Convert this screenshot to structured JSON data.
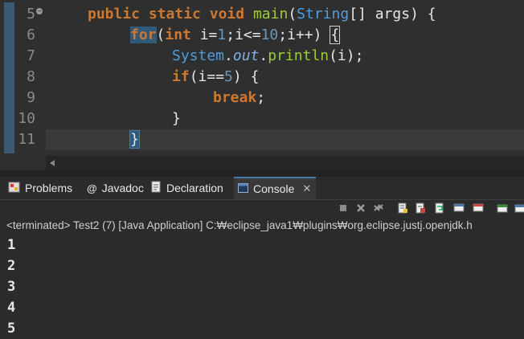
{
  "editor": {
    "line_numbers": [
      "5",
      "6",
      "7",
      "8",
      "9",
      "10",
      "11"
    ],
    "line5": {
      "kw1": "public",
      "kw2": "static",
      "kw3": "void",
      "fn": "main",
      "p1": "(",
      "ty": "String",
      "p2": "[] ",
      "arg": "args",
      "p3": ") {"
    },
    "line6": {
      "kw": "for",
      "p1": "(",
      "ty": "int",
      "p2": " i=",
      "n1": "1",
      "p3": ";i<=",
      "n2": "10",
      "p4": ";i++) ",
      "brace": "{"
    },
    "line7": {
      "ty": "System",
      "dot1": ".",
      "it": "out",
      "dot2": ".",
      "fn": "println",
      "rest": "(i);"
    },
    "line8": {
      "kw": "if",
      "p1": "(i==",
      "n": "5",
      "p2": ") {"
    },
    "line9": {
      "kw": "break",
      "p": ";"
    },
    "line10": {
      "p": "}"
    },
    "line11": {
      "p": "}"
    }
  },
  "tabs": [
    {
      "label": "Problems",
      "icon": "problems-icon"
    },
    {
      "label": "Javadoc",
      "icon": "javadoc-icon"
    },
    {
      "label": "Declaration",
      "icon": "declaration-icon"
    },
    {
      "label": "Console",
      "icon": "console-icon",
      "active": true,
      "close": "✕"
    }
  ],
  "console": {
    "status": "<terminated> Test2 (7) [Java Application] C:₩eclipse_java1₩plugins₩org.eclipse.justj.openjdk.h",
    "output": [
      "1",
      "2",
      "3",
      "4",
      "5"
    ]
  },
  "colors": {
    "keyword": "#cc7832",
    "type": "#4d9de0",
    "method": "#9ccc3c",
    "number": "#6897bb",
    "background": "#2b2b2b"
  }
}
